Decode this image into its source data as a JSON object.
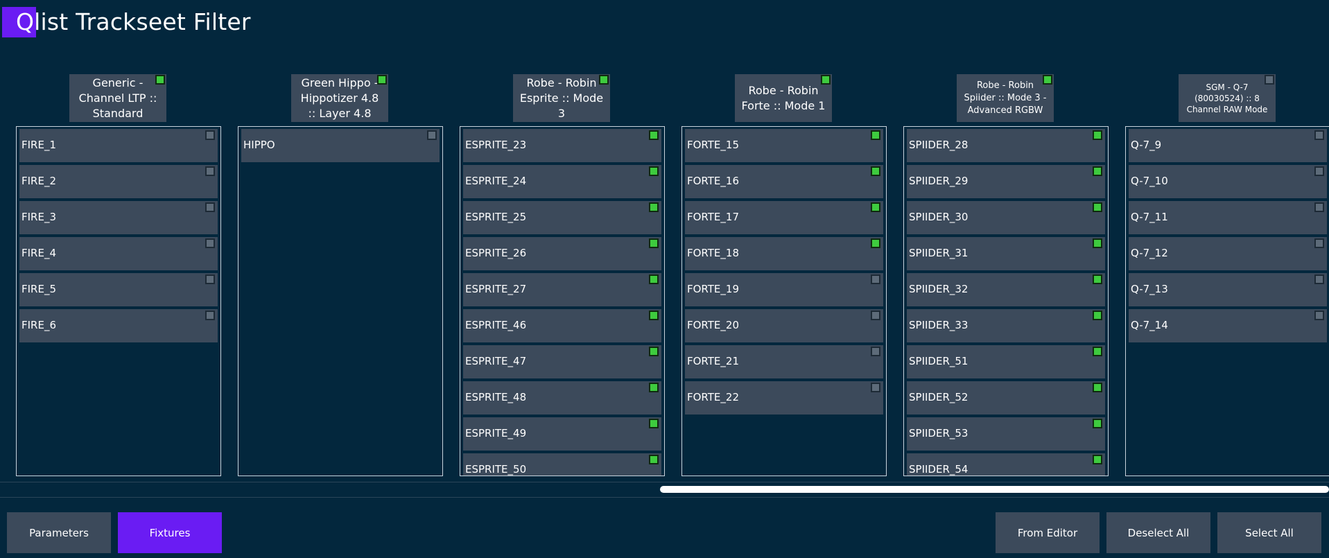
{
  "app": {
    "title": "Qlist Trackseet Filter"
  },
  "columns": [
    {
      "header": "Generic - Channel LTP :: Standard",
      "checked": true,
      "items": [
        {
          "label": "FIRE_1",
          "checked": false
        },
        {
          "label": "FIRE_2",
          "checked": false
        },
        {
          "label": "FIRE_3",
          "checked": false
        },
        {
          "label": "FIRE_4",
          "checked": false
        },
        {
          "label": "FIRE_5",
          "checked": false
        },
        {
          "label": "FIRE_6",
          "checked": false
        }
      ]
    },
    {
      "header": "Green Hippo - Hippotizer 4.8 :: Layer 4.8",
      "checked": true,
      "items": [
        {
          "label": "HIPPO",
          "checked": false
        }
      ]
    },
    {
      "header": "Robe - Robin Esprite :: Mode 3",
      "checked": true,
      "items": [
        {
          "label": "ESPRITE_23",
          "checked": true
        },
        {
          "label": "ESPRITE_24",
          "checked": true
        },
        {
          "label": "ESPRITE_25",
          "checked": true
        },
        {
          "label": "ESPRITE_26",
          "checked": true
        },
        {
          "label": "ESPRITE_27",
          "checked": true
        },
        {
          "label": "ESPRITE_46",
          "checked": true
        },
        {
          "label": "ESPRITE_47",
          "checked": true
        },
        {
          "label": "ESPRITE_48",
          "checked": true
        },
        {
          "label": "ESPRITE_49",
          "checked": true
        },
        {
          "label": "ESPRITE_50",
          "checked": true
        }
      ]
    },
    {
      "header": "Robe - Robin Forte :: Mode 1",
      "checked": true,
      "items": [
        {
          "label": "FORTE_15",
          "checked": true
        },
        {
          "label": "FORTE_16",
          "checked": true
        },
        {
          "label": "FORTE_17",
          "checked": true
        },
        {
          "label": "FORTE_18",
          "checked": true
        },
        {
          "label": "FORTE_19",
          "checked": false
        },
        {
          "label": "FORTE_20",
          "checked": false
        },
        {
          "label": "FORTE_21",
          "checked": false
        },
        {
          "label": "FORTE_22",
          "checked": false
        }
      ]
    },
    {
      "header": "Robe - Robin Spiider :: Mode 3 - Advanced RGBW",
      "checked": true,
      "items": [
        {
          "label": "SPIIDER_28",
          "checked": true
        },
        {
          "label": "SPIIDER_29",
          "checked": true
        },
        {
          "label": "SPIIDER_30",
          "checked": true
        },
        {
          "label": "SPIIDER_31",
          "checked": true
        },
        {
          "label": "SPIIDER_32",
          "checked": true
        },
        {
          "label": "SPIIDER_33",
          "checked": true
        },
        {
          "label": "SPIIDER_51",
          "checked": true
        },
        {
          "label": "SPIIDER_52",
          "checked": true
        },
        {
          "label": "SPIIDER_53",
          "checked": true
        },
        {
          "label": "SPIIDER_54",
          "checked": true
        }
      ]
    },
    {
      "header": "SGM - Q-7 (80030524) :: 8 Channel RAW Mode",
      "checked": false,
      "items": [
        {
          "label": "Q-7_9",
          "checked": false
        },
        {
          "label": "Q-7_10",
          "checked": false
        },
        {
          "label": "Q-7_11",
          "checked": false
        },
        {
          "label": "Q-7_12",
          "checked": false
        },
        {
          "label": "Q-7_13",
          "checked": false
        },
        {
          "label": "Q-7_14",
          "checked": false
        }
      ]
    }
  ],
  "footer": {
    "parameters_label": "Parameters",
    "fixtures_label": "Fixtures",
    "from_editor_label": "From Editor",
    "deselect_all_label": "Deselect All",
    "select_all_label": "Select All"
  },
  "colors": {
    "background": "#03273d",
    "accent": "#6a1cf3",
    "panel": "#3c4a5b",
    "check_on": "#3ecb3e",
    "check_off": "#5d6b79"
  }
}
